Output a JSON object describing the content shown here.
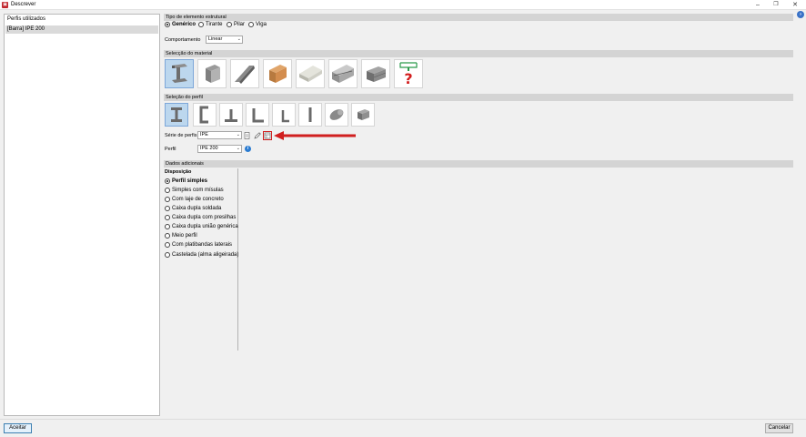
{
  "window": {
    "title": "Descrever",
    "app_icon": "app-icon"
  },
  "left_panel": {
    "header": "Perfis utilizados",
    "items": [
      {
        "label": "[Barra] IPE 200",
        "selected": true
      }
    ]
  },
  "tipo": {
    "header": "Tipo de elemento estrutural",
    "options": [
      {
        "label": "Genérico",
        "selected": true
      },
      {
        "label": "Tirante",
        "selected": false
      },
      {
        "label": "Pilar",
        "selected": false
      },
      {
        "label": "Viga",
        "selected": false
      }
    ],
    "comportamento_label": "Comportamento",
    "comportamento_value": "Linear"
  },
  "material": {
    "header": "Selecção do material",
    "tiles": [
      {
        "icon": "hot-rolled-steel-icon",
        "selected": true
      },
      {
        "icon": "concrete-beam-icon",
        "selected": false
      },
      {
        "icon": "cold-formed-steel-icon",
        "selected": false
      },
      {
        "icon": "wood-beam-icon",
        "selected": false
      },
      {
        "icon": "composite-slab-icon",
        "selected": false
      },
      {
        "icon": "aluminium-profile-icon",
        "selected": false
      },
      {
        "icon": "masonry-icon",
        "selected": false
      },
      {
        "icon": "generic-section-icon",
        "selected": false
      }
    ]
  },
  "perfil": {
    "header": "Seleção do perfil",
    "tiles": [
      {
        "icon": "i-section-icon",
        "selected": true
      },
      {
        "icon": "channel-section-icon",
        "selected": false
      },
      {
        "icon": "t-section-icon",
        "selected": false
      },
      {
        "icon": "angle-section-icon",
        "selected": false
      },
      {
        "icon": "unequal-angle-icon",
        "selected": false
      },
      {
        "icon": "plate-section-icon",
        "selected": false
      },
      {
        "icon": "round-tube-icon",
        "selected": false
      },
      {
        "icon": "rect-tube-icon",
        "selected": false
      }
    ],
    "serie_label": "Série de perfis",
    "serie_value": "IPE",
    "perfil_label": "Perfil",
    "perfil_value": "IPE 200"
  },
  "dados": {
    "header": "Dados adicionais",
    "disposicao_label": "Disposição",
    "options": [
      {
        "label": "Perfil simples",
        "selected": true
      },
      {
        "label": "Simples com mísulas",
        "selected": false
      },
      {
        "label": "Com laje de concreto",
        "selected": false
      },
      {
        "label": "Caixa dupla soldada",
        "selected": false
      },
      {
        "label": "Caixa dupla com presilhas",
        "selected": false
      },
      {
        "label": "Caixa dupla união genérica",
        "selected": false
      },
      {
        "label": "Meio perfil",
        "selected": false
      },
      {
        "label": "Com platibandas laterais",
        "selected": false
      },
      {
        "label": "Castelada (alma aligeirada)",
        "selected": false
      }
    ]
  },
  "buttons": {
    "accept": "Aceitar",
    "cancel": "Cancelar"
  },
  "colors": {
    "selection": "#bcd7ee",
    "accent": "#3c7fb1",
    "annotation": "#d11f1f"
  }
}
